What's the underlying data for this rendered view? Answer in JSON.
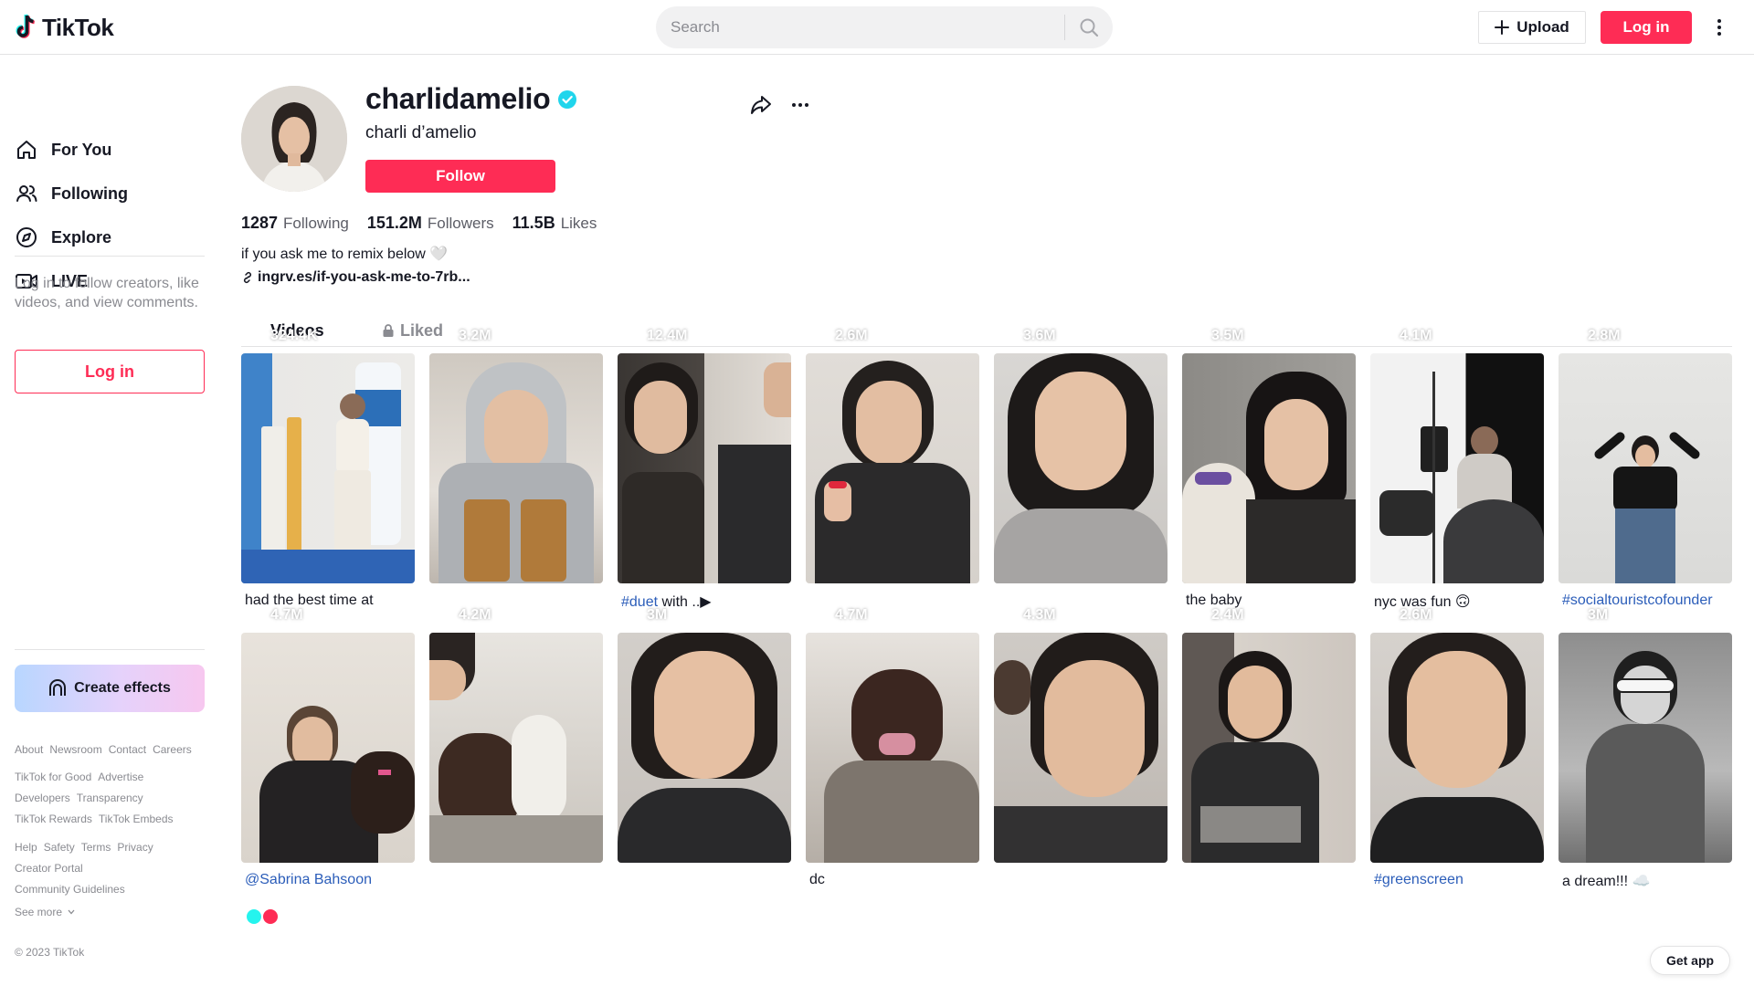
{
  "brand": {
    "name": "TikTok",
    "accent": "#fe2c55"
  },
  "header": {
    "search_placeholder": "Search",
    "upload_label": "Upload",
    "login_label": "Log in"
  },
  "sidebar": {
    "nav": [
      {
        "label": "For You",
        "icon": "home-icon"
      },
      {
        "label": "Following",
        "icon": "users-icon"
      },
      {
        "label": "Explore",
        "icon": "compass-icon"
      },
      {
        "label": "LIVE",
        "icon": "live-icon"
      }
    ],
    "login_prompt": "Log in to follow creators, like videos, and view comments.",
    "login_button": "Log in",
    "create_effects": "Create effects",
    "footer_rows": [
      [
        "About",
        "Newsroom",
        "Contact",
        "Careers"
      ],
      [
        "TikTok for Good",
        "Advertise"
      ],
      [
        "Developers",
        "Transparency"
      ],
      [
        "TikTok Rewards",
        "TikTok Embeds"
      ],
      [
        "Help",
        "Safety",
        "Terms",
        "Privacy"
      ],
      [
        "Creator Portal"
      ],
      [
        "Community Guidelines"
      ]
    ],
    "see_more": "See more",
    "copyright": "© 2023 TikTok"
  },
  "profile": {
    "username": "charlidamelio",
    "display_name": "charli d’amelio",
    "follow_label": "Follow",
    "stats": [
      {
        "value": "1287",
        "label": "Following"
      },
      {
        "value": "151.2M",
        "label": "Followers"
      },
      {
        "value": "11.5B",
        "label": "Likes"
      }
    ],
    "bio": "if you ask me to remix below 🤍",
    "link": "ingrv.es/if-you-ask-me-to-7rb..."
  },
  "tabs": {
    "videos": "Videos",
    "liked": "Liked"
  },
  "videos": [
    {
      "views": "324.4K",
      "caption": "had the best time at",
      "caption_type": "text"
    },
    {
      "views": "3.2M",
      "caption": "",
      "caption_type": "text"
    },
    {
      "views": "12.4M",
      "caption": "#duet",
      "caption_suffix": " with ..▶",
      "caption_type": "tag"
    },
    {
      "views": "2.6M",
      "caption": "",
      "caption_type": "text"
    },
    {
      "views": "3.6M",
      "caption": "",
      "caption_type": "text"
    },
    {
      "views": "3.5M",
      "caption": "the baby",
      "caption_type": "text"
    },
    {
      "views": "4.1M",
      "caption": "nyc was fun 🙃",
      "caption_type": "text"
    },
    {
      "views": "2.8M",
      "caption": "#socialtouristcofounder",
      "caption_type": "tag"
    },
    {
      "views": "4.7M",
      "caption": "@Sabrina Bahsoon",
      "caption_type": "tag"
    },
    {
      "views": "4.2M",
      "caption": "",
      "caption_type": "text"
    },
    {
      "views": "3M",
      "caption": "",
      "caption_type": "text"
    },
    {
      "views": "4.7M",
      "caption": "dc",
      "caption_type": "text"
    },
    {
      "views": "4.3M",
      "caption": "",
      "caption_type": "text"
    },
    {
      "views": "2.4M",
      "caption": "",
      "caption_type": "text"
    },
    {
      "views": "2.6M",
      "caption": "#greenscreen",
      "caption_type": "tag"
    },
    {
      "views": "3M",
      "caption": "a dream!!! ☁️",
      "caption_type": "text"
    }
  ],
  "get_app": "Get app"
}
